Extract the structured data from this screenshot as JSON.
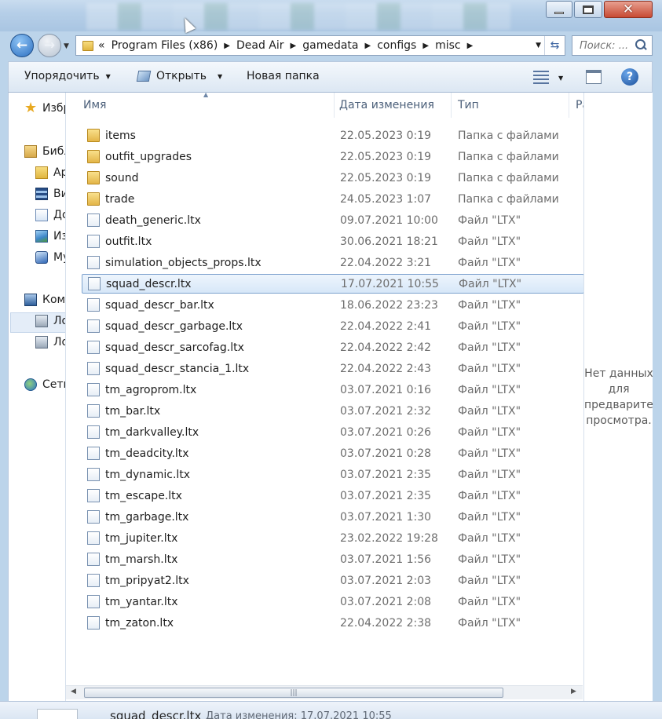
{
  "window": {
    "minimize_glyph": "",
    "maximize_glyph": "",
    "close_glyph": "✕"
  },
  "nav": {
    "back_glyph": "←",
    "forward_glyph": "→",
    "address": {
      "overflow": "«",
      "crumbs": [
        "Program Files (x86)",
        "Dead Air",
        "gamedata",
        "configs",
        "misc"
      ]
    },
    "search_placeholder": "Поиск: ..."
  },
  "toolbar": {
    "organize": "Упорядочить",
    "open": "Открыть",
    "new_folder": "Новая папка"
  },
  "sidebar": {
    "favorites": "Избранное",
    "libraries": "Библиотеки",
    "lib_items": [
      "Архивы",
      "Видео",
      "Документы",
      "Изображения",
      "Музыка"
    ],
    "computer": "Компьютер",
    "drives": [
      "Локальный диск (C:)",
      "Локальный диск (D:)"
    ],
    "network": "Сеть"
  },
  "columns": {
    "name": "Имя",
    "date": "Дата изменения",
    "type": "Тип",
    "size": "Размер"
  },
  "files": [
    {
      "name": "items",
      "date": "22.05.2023 0:19",
      "type": "Папка с файлами",
      "kind": "folder"
    },
    {
      "name": "outfit_upgrades",
      "date": "22.05.2023 0:19",
      "type": "Папка с файлами",
      "kind": "folder"
    },
    {
      "name": "sound",
      "date": "22.05.2023 0:19",
      "type": "Папка с файлами",
      "kind": "folder"
    },
    {
      "name": "trade",
      "date": "24.05.2023 1:07",
      "type": "Папка с файлами",
      "kind": "folder"
    },
    {
      "name": "death_generic.ltx",
      "date": "09.07.2021 10:00",
      "type": "Файл \"LTX\"",
      "kind": "file"
    },
    {
      "name": "outfit.ltx",
      "date": "30.06.2021 18:21",
      "type": "Файл \"LTX\"",
      "kind": "file"
    },
    {
      "name": "simulation_objects_props.ltx",
      "date": "22.04.2022 3:21",
      "type": "Файл \"LTX\"",
      "kind": "file"
    },
    {
      "name": "squad_descr.ltx",
      "date": "17.07.2021 10:55",
      "type": "Файл \"LTX\"",
      "kind": "file",
      "selected": true
    },
    {
      "name": "squad_descr_bar.ltx",
      "date": "18.06.2022 23:23",
      "type": "Файл \"LTX\"",
      "kind": "file"
    },
    {
      "name": "squad_descr_garbage.ltx",
      "date": "22.04.2022 2:41",
      "type": "Файл \"LTX\"",
      "kind": "file"
    },
    {
      "name": "squad_descr_sarcofag.ltx",
      "date": "22.04.2022 2:42",
      "type": "Файл \"LTX\"",
      "kind": "file"
    },
    {
      "name": "squad_descr_stancia_1.ltx",
      "date": "22.04.2022 2:43",
      "type": "Файл \"LTX\"",
      "kind": "file"
    },
    {
      "name": "tm_agroprom.ltx",
      "date": "03.07.2021 0:16",
      "type": "Файл \"LTX\"",
      "kind": "file"
    },
    {
      "name": "tm_bar.ltx",
      "date": "03.07.2021 2:32",
      "type": "Файл \"LTX\"",
      "kind": "file"
    },
    {
      "name": "tm_darkvalley.ltx",
      "date": "03.07.2021 0:26",
      "type": "Файл \"LTX\"",
      "kind": "file"
    },
    {
      "name": "tm_deadcity.ltx",
      "date": "03.07.2021 0:28",
      "type": "Файл \"LTX\"",
      "kind": "file"
    },
    {
      "name": "tm_dynamic.ltx",
      "date": "03.07.2021 2:35",
      "type": "Файл \"LTX\"",
      "kind": "file"
    },
    {
      "name": "tm_escape.ltx",
      "date": "03.07.2021 2:35",
      "type": "Файл \"LTX\"",
      "kind": "file"
    },
    {
      "name": "tm_garbage.ltx",
      "date": "03.07.2021 1:30",
      "type": "Файл \"LTX\"",
      "kind": "file"
    },
    {
      "name": "tm_jupiter.ltx",
      "date": "23.02.2022 19:28",
      "type": "Файл \"LTX\"",
      "kind": "file"
    },
    {
      "name": "tm_marsh.ltx",
      "date": "03.07.2021 1:56",
      "type": "Файл \"LTX\"",
      "kind": "file"
    },
    {
      "name": "tm_pripyat2.ltx",
      "date": "03.07.2021 2:03",
      "type": "Файл \"LTX\"",
      "kind": "file"
    },
    {
      "name": "tm_yantar.ltx",
      "date": "03.07.2021 2:08",
      "type": "Файл \"LTX\"",
      "kind": "file"
    },
    {
      "name": "tm_zaton.ltx",
      "date": "22.04.2022 2:38",
      "type": "Файл \"LTX\"",
      "kind": "file"
    }
  ],
  "preview": {
    "line1": "Нет данных",
    "line2": "для",
    "line3": "предварительного",
    "line4": "просмотра."
  },
  "details": {
    "name": "squad_descr.ltx",
    "meta_label": "Дата изменения:",
    "meta_value": "17.07.2021 10:55"
  },
  "colors": {
    "accent": "#2c6fc0",
    "selection": "#d7e7f8"
  }
}
